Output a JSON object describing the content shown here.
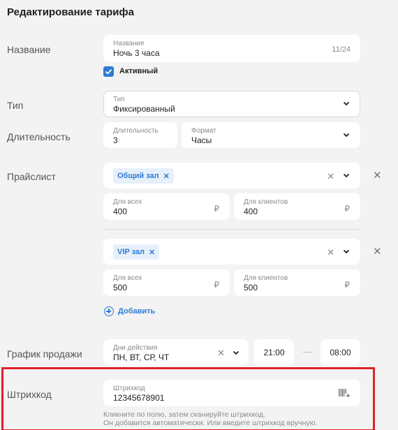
{
  "page_title": "Редактирование тарифа",
  "rows": {
    "name": {
      "label": "Название",
      "field_label": "Название",
      "value": "Ночь 3 часа",
      "counter": "11/24"
    },
    "active": {
      "label": "Активный",
      "checked": true
    },
    "type": {
      "label": "Тип",
      "field_label": "Тип",
      "value": "Фиксированный"
    },
    "duration": {
      "label": "Длительность",
      "field_label": "Длительность",
      "value": "3",
      "format_label": "Формат",
      "format_value": "Часы"
    },
    "pricelist": {
      "label": "Прайслист",
      "groups": [
        {
          "chip": "Общий зал",
          "all_label": "Для всех",
          "all_value": "400",
          "clients_label": "Для клиентов",
          "clients_value": "400",
          "currency": "₽"
        },
        {
          "chip": "VIP зал",
          "all_label": "Для всех",
          "all_value": "500",
          "clients_label": "Для клиентов",
          "clients_value": "500",
          "currency": "₽"
        }
      ],
      "add_label": "Добавить"
    },
    "schedule": {
      "label": "График продажи",
      "days_label": "Дни действия",
      "days_value": "ПН, ВТ, СР, ЧТ",
      "time_from": "21:00",
      "time_to": "08:00"
    },
    "barcode": {
      "label": "Штрихкод",
      "field_label": "Штрихкод",
      "value": "12345678901",
      "hint_line1": "Кликните по полю, затем сканируйте штрихкод.",
      "hint_line2": "Он добавится автоматически. Или введите штрихкод вручную."
    }
  },
  "colors": {
    "accent": "#2e7bd6",
    "highlight_box": "#e0202a",
    "background": "#f3f3f3"
  },
  "icons": [
    "check-icon",
    "chevron-down-icon",
    "close-icon",
    "plus-circle-icon",
    "barcode-scan-icon"
  ]
}
